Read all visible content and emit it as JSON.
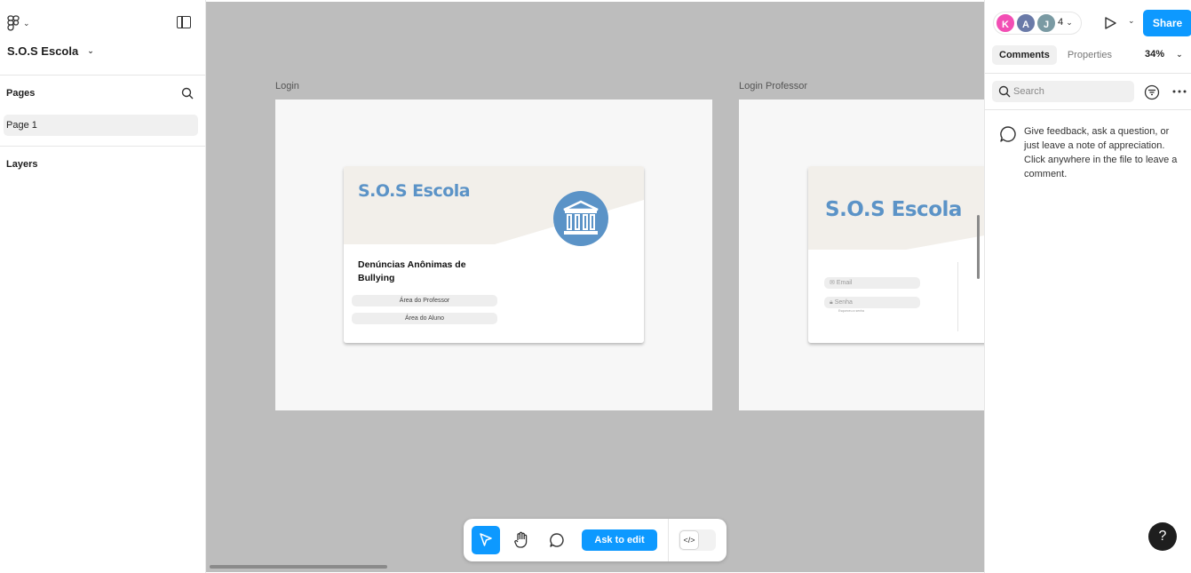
{
  "left_panel": {
    "file_name": "S.O.S Escola",
    "pages_title": "Pages",
    "pages": [
      {
        "label": "Page 1"
      }
    ],
    "layers_title": "Layers"
  },
  "canvas": {
    "frames": [
      {
        "label": "Login",
        "brand": "S.O.S Escola",
        "headline": "Denúncias Anônimas de Bullying",
        "buttons": [
          "Área do Professor",
          "Área do Aluno"
        ]
      },
      {
        "label": "Login Professor",
        "brand": "S.O.S Escola",
        "fields": [
          {
            "placeholder": "Email",
            "icon": "mail-icon"
          },
          {
            "placeholder": "Senha",
            "icon": "lock-icon"
          }
        ],
        "small_link": "Esqueceu a senha"
      }
    ]
  },
  "toolbar": {
    "tools": [
      "move-tool",
      "hand-tool",
      "comment-tool"
    ],
    "ask_to_edit": "Ask to edit"
  },
  "right_panel": {
    "avatars": [
      {
        "initial": "K",
        "color": "#f24eb4"
      },
      {
        "initial": "A",
        "color": "#6a7aa8"
      },
      {
        "initial": "J",
        "color": "#7a9aa3"
      }
    ],
    "collaborator_count": "4",
    "share_label": "Share",
    "tabs": [
      {
        "label": "Comments",
        "active": true
      },
      {
        "label": "Properties",
        "active": false
      }
    ],
    "zoom": "34%",
    "search_placeholder": "Search",
    "comment_hint": "Give feedback, ask a question, or just leave a note of appreciation. Click anywhere in the file to leave a comment.",
    "help": "?"
  },
  "colors": {
    "accent": "#0d99ff",
    "brand_blue": "#5b93c7",
    "canvas_bg": "#bdbdbd"
  }
}
